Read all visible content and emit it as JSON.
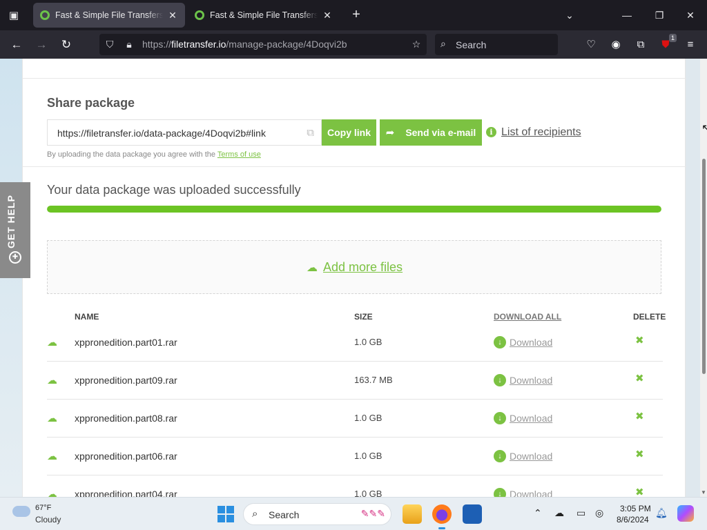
{
  "browser": {
    "tabs": [
      {
        "title": "Fast & Simple File Transfers - FileTransfer.io",
        "active": true
      },
      {
        "title": "Fast & Simple File Transfers - FileTransfer.io",
        "active": false
      }
    ],
    "url_scheme": "https://",
    "url_host": "filetransfer.io",
    "url_path": "/manage-package/4Doqvi2b",
    "search_placeholder": "Search",
    "extension_badge": "1"
  },
  "share": {
    "title": "Share package",
    "link": "https://filetransfer.io/data-package/4Doqvi2b#link",
    "copy_label": "Copy link",
    "send_label": "Send via e-mail",
    "recipients_label": "List of recipients",
    "terms_prefix": "By uploading the data package you agree with the",
    "terms_link": "Terms of use"
  },
  "upload": {
    "status": "Your data package was uploaded successfully",
    "progress_percent": 100,
    "add_more": "Add more files"
  },
  "table": {
    "col_name": "NAME",
    "col_size": "SIZE",
    "col_download_all": "DOWNLOAD ALL",
    "col_delete": "DELETE",
    "download_label": "Download",
    "rows": [
      {
        "name": "xppronedition.part01.rar",
        "size": "1.0 GB"
      },
      {
        "name": "xppronedition.part09.rar",
        "size": "163.7 MB"
      },
      {
        "name": "xppronedition.part08.rar",
        "size": "1.0 GB"
      },
      {
        "name": "xppronedition.part06.rar",
        "size": "1.0 GB"
      },
      {
        "name": "xppronedition.part04.rar",
        "size": "1.0 GB"
      }
    ]
  },
  "get_help": "GET HELP",
  "taskbar": {
    "temp": "67°F",
    "condition": "Cloudy",
    "search_placeholder": "Search",
    "time": "3:05 PM",
    "date": "8/6/2024"
  },
  "colors": {
    "accent": "#7cc242",
    "progress": "#6cc424"
  }
}
